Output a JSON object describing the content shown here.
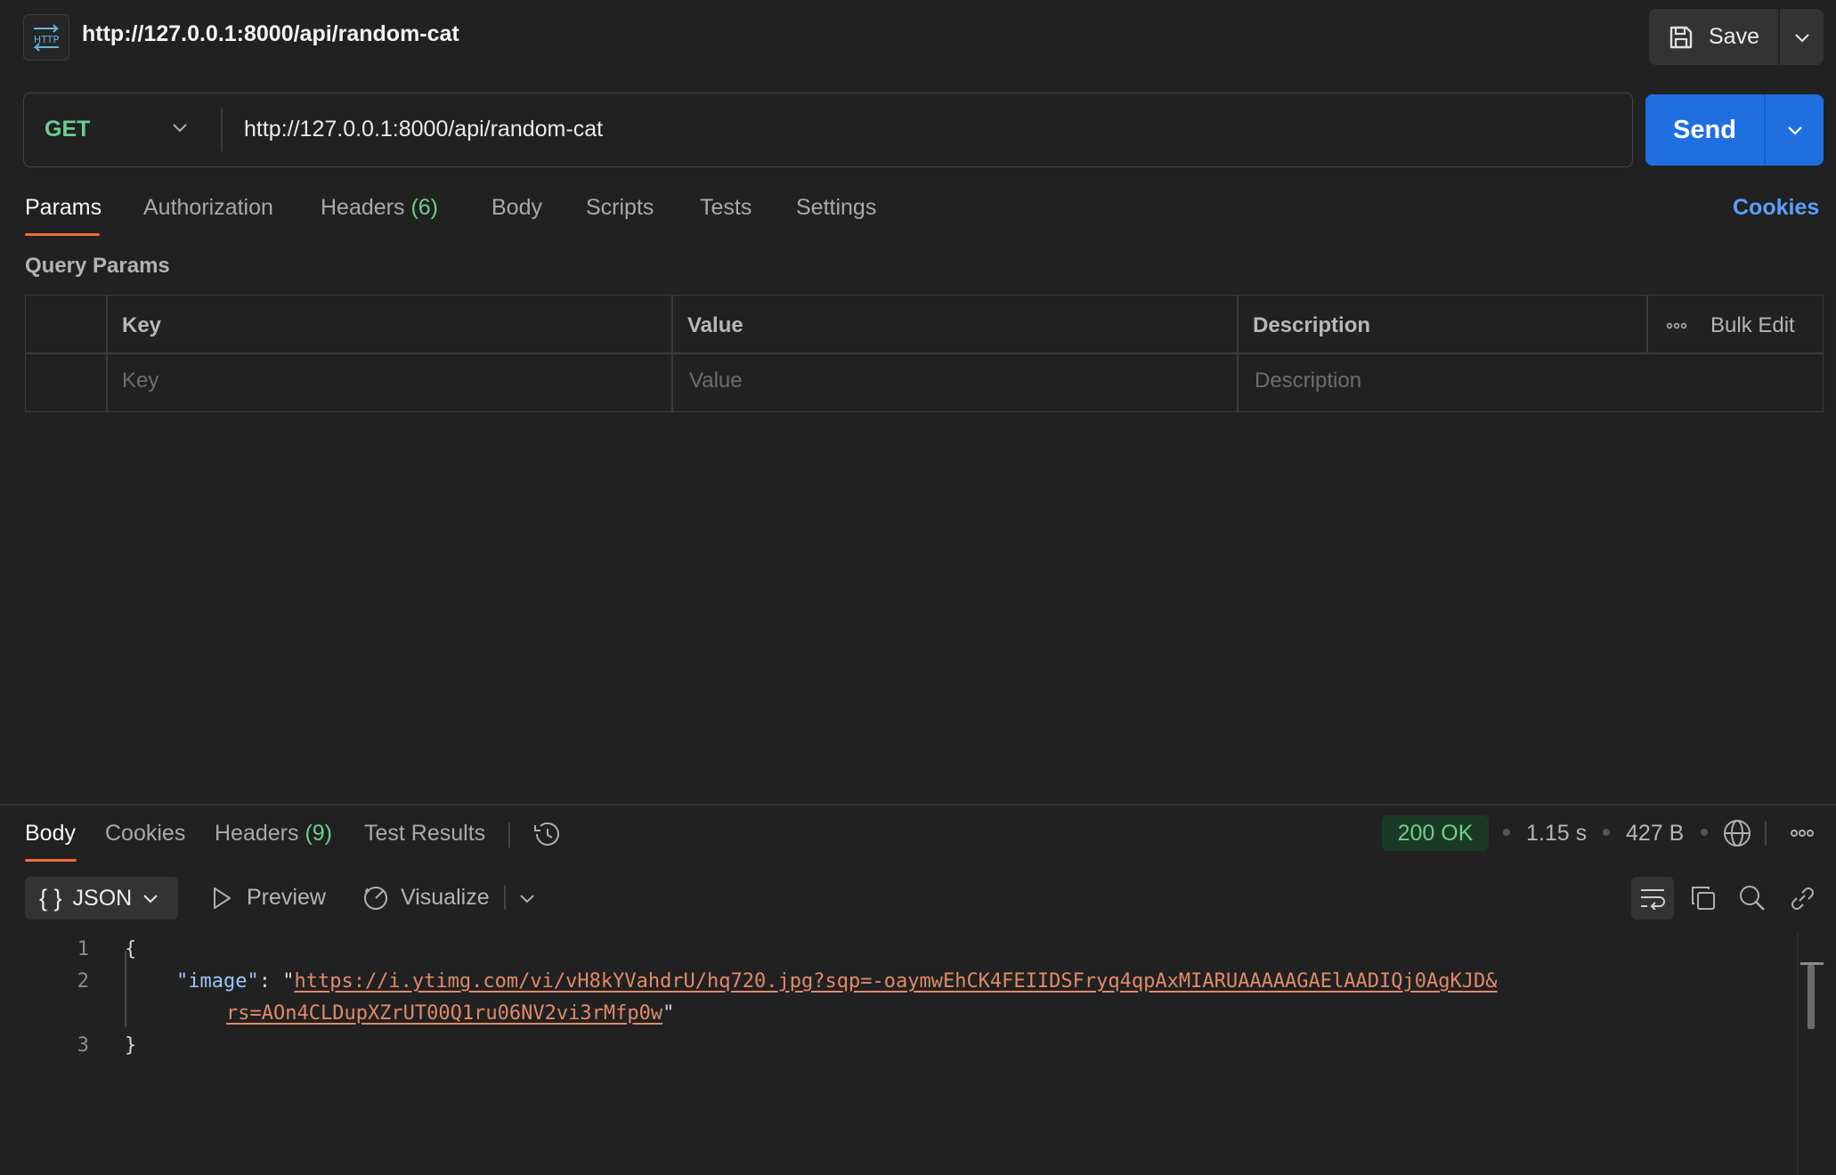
{
  "header": {
    "badge_text": "HTTP",
    "title": "http://127.0.0.1:8000/api/random-cat",
    "save_label": "Save"
  },
  "request": {
    "method": "GET",
    "url": "http://127.0.0.1:8000/api/random-cat",
    "send_label": "Send"
  },
  "request_tabs": {
    "params": "Params",
    "authorization": "Authorization",
    "headers": "Headers",
    "headers_count": "(6)",
    "body": "Body",
    "scripts": "Scripts",
    "tests": "Tests",
    "settings": "Settings",
    "cookies": "Cookies"
  },
  "query_params": {
    "section_label": "Query Params",
    "columns": {
      "key": "Key",
      "value": "Value",
      "description": "Description"
    },
    "bulk_edit": "Bulk Edit",
    "placeholders": {
      "key": "Key",
      "value": "Value",
      "description": "Description"
    }
  },
  "response_tabs": {
    "body": "Body",
    "cookies": "Cookies",
    "headers": "Headers",
    "headers_count": "(9)",
    "test_results": "Test Results"
  },
  "response_meta": {
    "status": "200 OK",
    "time": "1.15 s",
    "size": "427 B"
  },
  "response_toolbar": {
    "format": "JSON",
    "preview": "Preview",
    "visualize": "Visualize"
  },
  "response_body": {
    "line_numbers": [
      "1",
      "2",
      "3"
    ],
    "open_brace": "{",
    "key": "\"image\"",
    "colon": ":",
    "quote": "\"",
    "url_part1": "https://i.ytimg.com/vi/vH8kYVahdrU/hq720.jpg?sqp=-oaymwEhCK4FEIIDSFryq4qpAxMIARUAAAAAGAElAADIQj0AgKJD&",
    "url_part2": "rs=AOn4CLDupXZrUT00Q1ru06NV2vi3rMfp0w",
    "close_brace": "}"
  },
  "colors": {
    "accent_orange": "#f26b3a",
    "send_blue": "#1f6fe0",
    "success_green": "#6ccf8e",
    "link_blue": "#5aa0ff"
  },
  "icons": [
    "http-icon",
    "save-icon",
    "chevron-down-icon",
    "history-icon",
    "globe-icon",
    "more-icon",
    "play-icon",
    "visualize-icon",
    "wrap-lines-icon",
    "copy-icon",
    "search-icon",
    "link-icon"
  ]
}
